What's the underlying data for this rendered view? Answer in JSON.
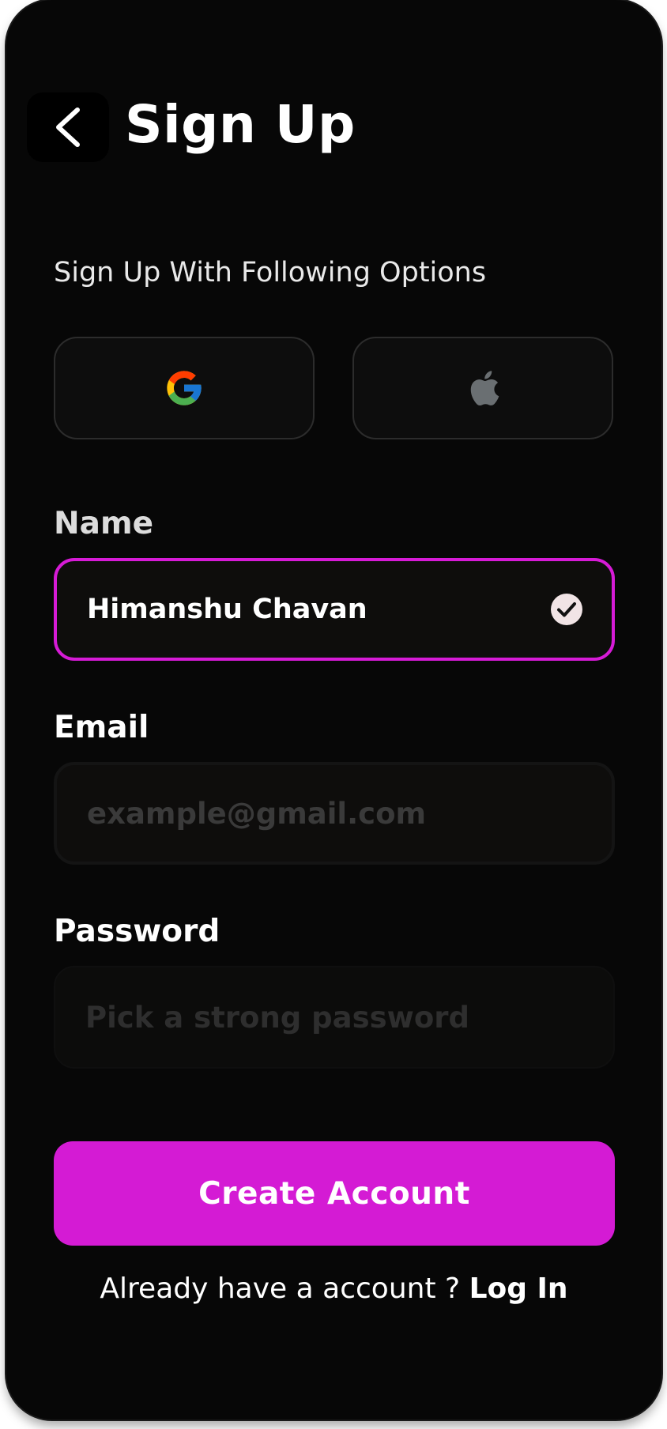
{
  "header": {
    "title": "Sign Up",
    "back_icon": "chevron-left-icon"
  },
  "social": {
    "prompt": "Sign Up With Following Options",
    "providers": [
      {
        "name": "Google",
        "icon": "google-icon"
      },
      {
        "name": "Apple",
        "icon": "apple-icon"
      }
    ]
  },
  "form": {
    "name": {
      "label": "Name",
      "value": "Himanshu Chavan",
      "valid": true,
      "focus_color": "#d61bd6"
    },
    "email": {
      "label": "Email",
      "value": "",
      "placeholder": "example@gmail.com"
    },
    "password": {
      "label": "Password",
      "value": "",
      "placeholder": "Pick a strong password"
    }
  },
  "actions": {
    "create_label": "Create Account",
    "accent": "#d41bd4"
  },
  "footer": {
    "prompt": "Already have a account ? ",
    "login_label": "Log In"
  }
}
